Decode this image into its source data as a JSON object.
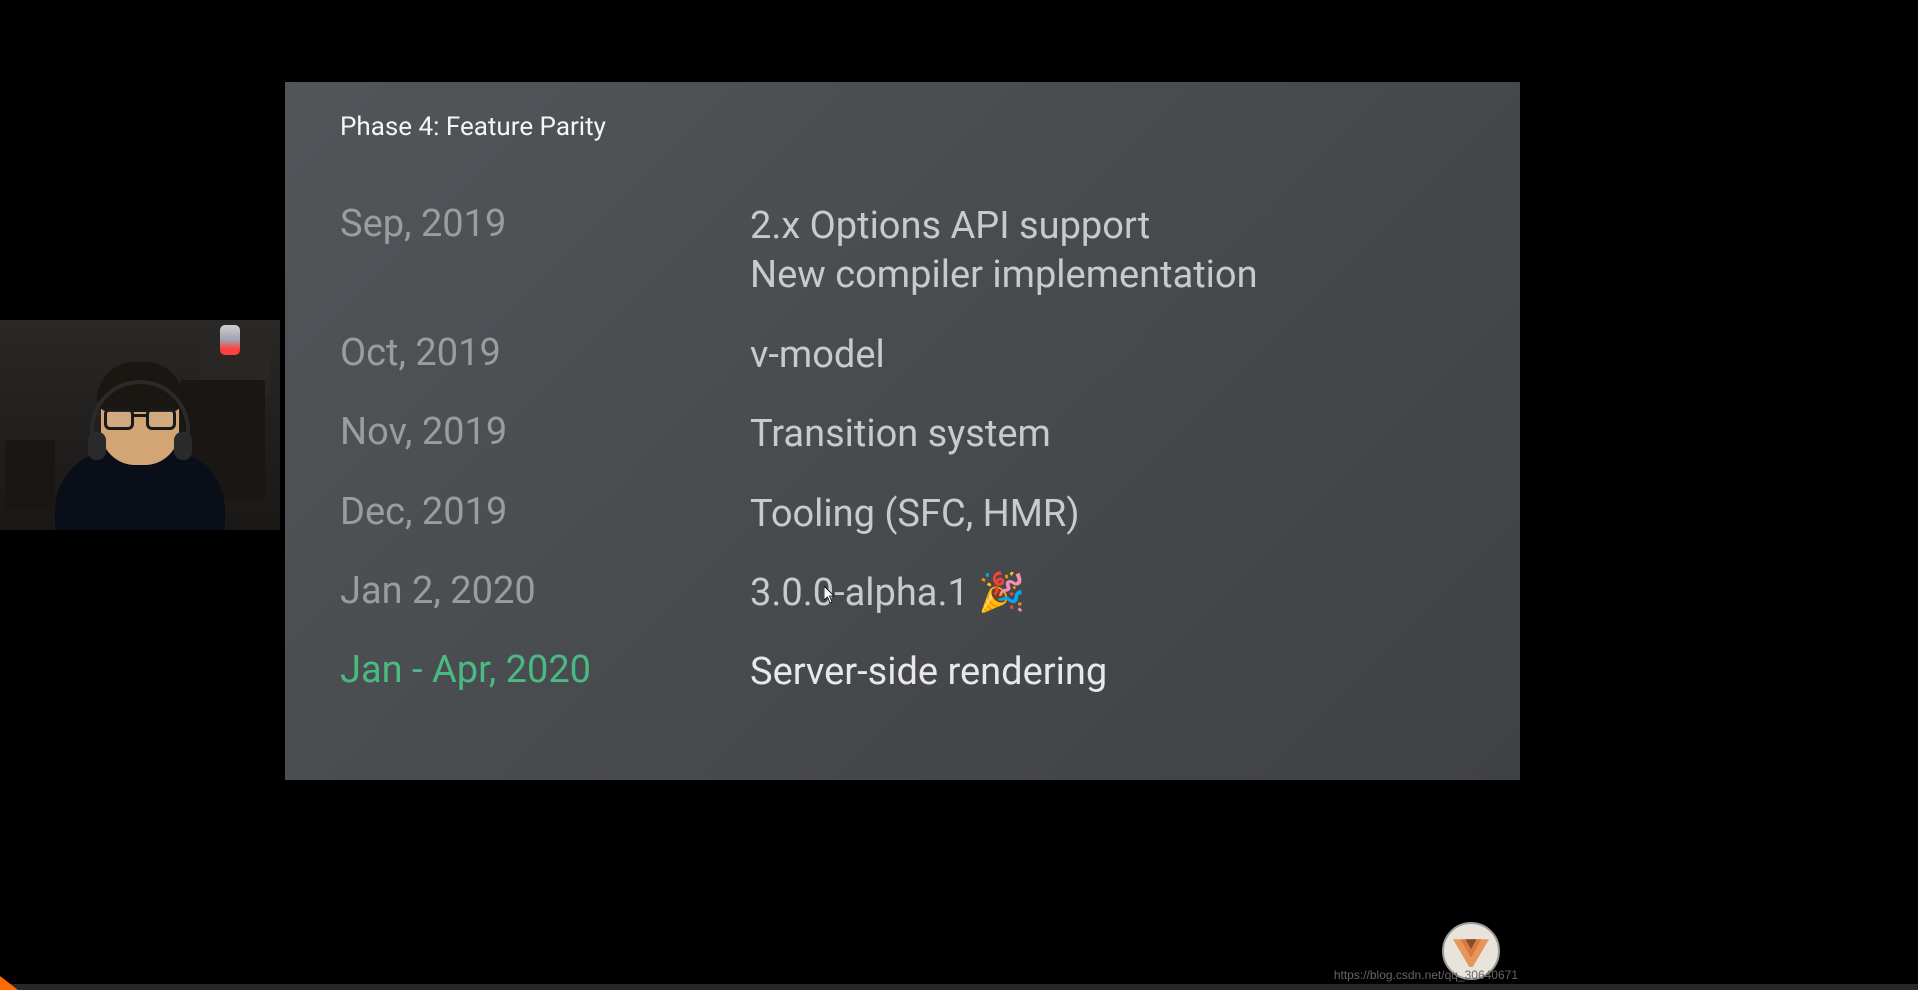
{
  "slide": {
    "title": "Phase 4: Feature Parity",
    "timeline": [
      {
        "date": "Sep, 2019",
        "desc": "2.x Options API support\nNew compiler implementation",
        "highlight": false,
        "bright": false
      },
      {
        "date": "Oct, 2019",
        "desc": "v-model",
        "highlight": false,
        "bright": false
      },
      {
        "date": "Nov, 2019",
        "desc": "Transition system",
        "highlight": false,
        "bright": false
      },
      {
        "date": "Dec, 2019",
        "desc": "Tooling (SFC, HMR)",
        "highlight": false,
        "bright": false
      },
      {
        "date": "Jan 2, 2020",
        "desc": "3.0.0-alpha.1 🎉",
        "highlight": false,
        "bright": false
      },
      {
        "date": "Jan - Apr, 2020",
        "desc": "Server-side rendering",
        "highlight": true,
        "bright": true
      }
    ]
  },
  "watermark": "https://blog.csdn.net/qq_30640671"
}
